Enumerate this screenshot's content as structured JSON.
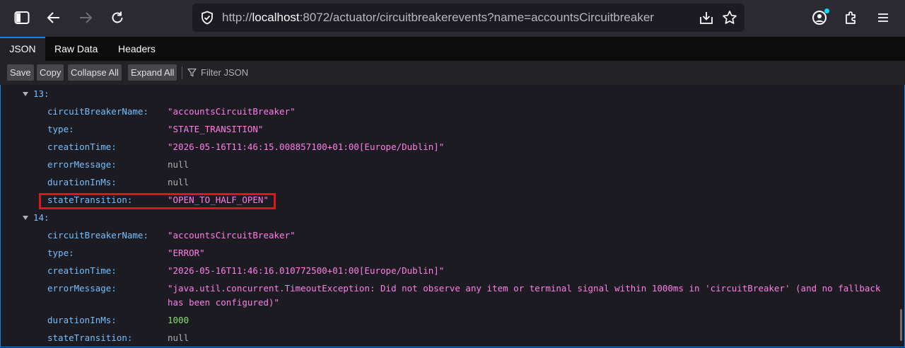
{
  "browser": {
    "url_prefix": "http://",
    "url_host": "localhost",
    "url_rest": ":8072/actuator/circuitbreakerevents?name=accountsCircuitbreaker",
    "accent_color": "#00ddff"
  },
  "viewer": {
    "tabs": [
      "JSON",
      "Raw Data",
      "Headers"
    ],
    "active_tab": "JSON",
    "buttons": [
      "Save",
      "Copy",
      "Collapse All",
      "Expand All"
    ],
    "filter_placeholder": "Filter JSON"
  },
  "events": [
    {
      "index": "13:",
      "fields": [
        {
          "key": "circuitBreakerName:",
          "value": "\"accountsCircuitBreaker\"",
          "type": "string"
        },
        {
          "key": "type:",
          "value": "\"STATE_TRANSITION\"",
          "type": "string"
        },
        {
          "key": "creationTime:",
          "value": "\"2026-05-16T11:46:15.008857100+01:00[Europe/Dublin]\"",
          "type": "string"
        },
        {
          "key": "errorMessage:",
          "value": "null",
          "type": "null"
        },
        {
          "key": "durationInMs:",
          "value": "null",
          "type": "null"
        },
        {
          "key": "stateTransition:",
          "value": "\"OPEN_TO_HALF_OPEN\"",
          "type": "string"
        }
      ]
    },
    {
      "index": "14:",
      "fields": [
        {
          "key": "circuitBreakerName:",
          "value": "\"accountsCircuitBreaker\"",
          "type": "string"
        },
        {
          "key": "type:",
          "value": "\"ERROR\"",
          "type": "string"
        },
        {
          "key": "creationTime:",
          "value": "\"2026-05-16T11:46:16.010772500+01:00[Europe/Dublin]\"",
          "type": "string"
        },
        {
          "key": "errorMessage:",
          "value": "\"java.util.concurrent.TimeoutException: Did not observe any item or terminal signal within 1000ms in 'circuitBreaker' (and no fallback",
          "value_line2": "has been configured)\"",
          "type": "string"
        },
        {
          "key": "durationInMs:",
          "value": "1000",
          "type": "number"
        },
        {
          "key": "stateTransition:",
          "value": "null",
          "type": "null"
        }
      ]
    }
  ],
  "colors": {
    "key": "#75bfff",
    "string": "#ff7de9",
    "number": "#86de74",
    "null": "#b1b1b3",
    "highlight": "#e0141e"
  }
}
